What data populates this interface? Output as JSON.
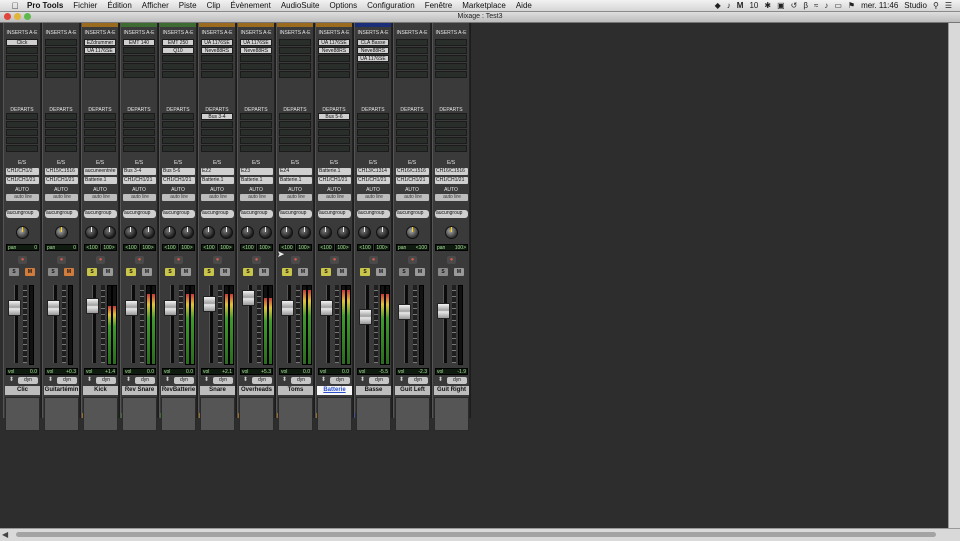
{
  "menubar": {
    "app": "Pro Tools",
    "items": [
      "Fichier",
      "Édition",
      "Afficher",
      "Piste",
      "Clip",
      "Évènement",
      "AudioSuite",
      "Options",
      "Configuration",
      "Fenêtre",
      "Marketplace",
      "Aide"
    ],
    "status_m": "M",
    "status_num": "10",
    "clock": "mer. 11:46",
    "user": "Studio"
  },
  "window": {
    "title": "Mixage : Test3"
  },
  "labels": {
    "inserts": "INSERTS A-E",
    "departs": "DEPARTS",
    "es": "E/S",
    "auto": "AUTO",
    "vol": "vol",
    "pan": "pan",
    "solo": "S",
    "mute": "M",
    "dyn": "dyn"
  },
  "colors": {
    "orange": "#9a6a1e",
    "green": "#3d6b32",
    "blue": "#1b2f78",
    "none": "#3a3a3a",
    "light_green": "#5c7a3b"
  },
  "strips": [
    {
      "name": "Clic",
      "inserts": [
        "Click"
      ],
      "sends": [],
      "io_in": "CH1/CH1/2",
      "io_out": "CH1/CH1/21",
      "auto": "auto lire",
      "group": "aucungroup",
      "mono": true,
      "pan": "0",
      "pan2": "",
      "vol": "0.0",
      "fader": 0.33,
      "meter": 0,
      "color": "none"
    },
    {
      "name": "Guitartémin",
      "inserts": [],
      "sends": [],
      "io_in": "CH15/C1516",
      "io_out": "CH1/CH1/21",
      "auto": "auto lire",
      "group": "aucungroup",
      "mono": true,
      "pan": "0",
      "pan2": "",
      "vol": "+0.3",
      "fader": 0.33,
      "meter": 0,
      "color": "none"
    },
    {
      "name": "Kick",
      "inserts": [
        "EZdrummer",
        "UA 1176SE"
      ],
      "sends": [],
      "io_in": "aucuneentrée",
      "io_out": "Batterie.1",
      "auto": "auto lire",
      "group": "aucungroup",
      "mono": false,
      "pan": "<100",
      "pan2": "100>",
      "vol": "+1.4",
      "fader": 0.3,
      "meter": 0.75,
      "color": "orange"
    },
    {
      "name": "Rev Snare",
      "inserts": [
        "EMT 140"
      ],
      "sends": [],
      "io_in": "Bus 3-4",
      "io_out": "CH1/CH1/21",
      "auto": "auto lire",
      "group": "aucungroup",
      "mono": false,
      "pan": "<100",
      "pan2": "100>",
      "vol": "0.0",
      "fader": 0.33,
      "meter": 0.9,
      "color": "green"
    },
    {
      "name": "RevBatterie",
      "inserts": [
        "EMT 250",
        "Q10"
      ],
      "sends": [],
      "io_in": "Bus 5-6",
      "io_out": "CH1/CH1/21",
      "auto": "auto lire",
      "group": "aucungroup",
      "mono": false,
      "pan": "<100",
      "pan2": "100>",
      "vol": "0.0",
      "fader": 0.33,
      "meter": 0.9,
      "color": "green"
    },
    {
      "name": "Snare",
      "inserts": [
        "UA 1176SE",
        "Neve88RS"
      ],
      "sends": [
        "Bus 3-4"
      ],
      "io_in": "EZ2",
      "io_out": "Batterie.1",
      "auto": "auto lire",
      "group": "aucungroup",
      "mono": false,
      "pan": "<100",
      "pan2": "100>",
      "vol": "+2.1",
      "fader": 0.27,
      "meter": 0.9,
      "color": "orange"
    },
    {
      "name": "Overheads",
      "inserts": [
        "UA 1176SE",
        "Neve88RS"
      ],
      "sends": [],
      "io_in": "EZ3",
      "io_out": "Batterie.1",
      "auto": "auto lire",
      "group": "aucungroup",
      "mono": false,
      "pan": "<100",
      "pan2": "100>",
      "vol": "+5.3",
      "fader": 0.18,
      "meter": 0.85,
      "color": "orange"
    },
    {
      "name": "Toms",
      "inserts": [],
      "sends": [],
      "io_in": "EZ4",
      "io_out": "Batterie.1",
      "auto": "auto lire",
      "group": "aucungroup",
      "mono": false,
      "pan": "<100",
      "pan2": "100>",
      "vol": "0.0",
      "fader": 0.33,
      "meter": 0.95,
      "color": "orange"
    },
    {
      "name": "Batterie",
      "inserts": [
        "UA 1176SE",
        "Neve88RS"
      ],
      "sends": [
        "Bus 5-6"
      ],
      "io_in": "Batterie.1",
      "io_out": "CH1/CH1/21",
      "auto": "auto lire",
      "group": "aucungroup",
      "mono": false,
      "pan": "<100",
      "pan2": "100>",
      "vol": "0.0",
      "fader": 0.33,
      "meter": 0.95,
      "color": "orange",
      "selected": true
    },
    {
      "name": "Basse",
      "inserts": [
        "CLA Basse",
        "Neve88RS",
        "UA 1176SE"
      ],
      "sends": [],
      "io_in": "CH13/C1314",
      "io_out": "CH1/CH1/21",
      "auto": "auto lire",
      "group": "aucungroup",
      "mono": false,
      "pan": "<100",
      "pan2": "100>",
      "vol": "-5.5",
      "fader": 0.46,
      "meter": 0.9,
      "color": "blue"
    },
    {
      "name": "Guit Left",
      "inserts": [],
      "sends": [],
      "io_in": "CH16/C1516",
      "io_out": "CH1/CH1/21",
      "auto": "auto lire",
      "group": "aucungroup",
      "mono": true,
      "pan": "<100",
      "pan2": "",
      "vol": "-2.3",
      "fader": 0.38,
      "meter": 0,
      "color": "none"
    },
    {
      "name": "Guit Right",
      "inserts": [],
      "sends": [],
      "io_in": "CH16/C1516",
      "io_out": "CH1/CH1/21",
      "auto": "auto lire",
      "group": "aucungroup",
      "mono": true,
      "pan": "100>",
      "pan2": "",
      "vol": "-1.9",
      "fader": 0.37,
      "meter": 0,
      "color": "none"
    }
  ]
}
